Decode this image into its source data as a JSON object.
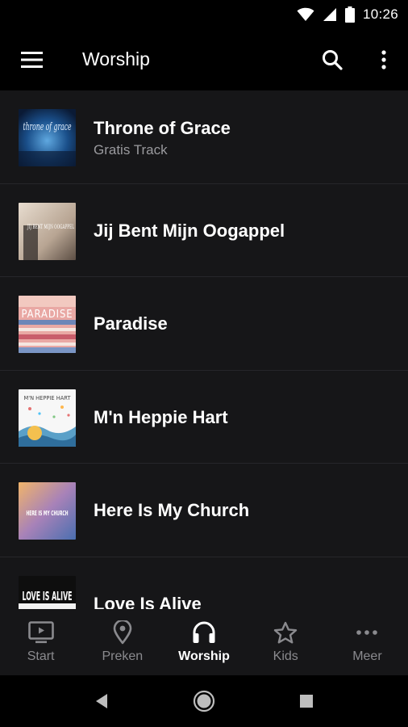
{
  "status": {
    "time": "10:26"
  },
  "header": {
    "title": "Worship"
  },
  "tracks": [
    {
      "title": "Throne of Grace",
      "subtitle": "Gratis Track",
      "art_text": "throne of grace"
    },
    {
      "title": "Jij Bent Mijn Oogappel",
      "art_text": "JIJ BENT MIJN OOGAPPEL"
    },
    {
      "title": "Paradise",
      "art_text": "PARADISE"
    },
    {
      "title": "M'n Heppie Hart",
      "art_text": "M'N HEPPIE HART"
    },
    {
      "title": "Here Is My Church",
      "art_text": "HERE IS MY CHURCH"
    },
    {
      "title": "Love Is Alive",
      "art_text": "LOVE IS ALIVE"
    }
  ],
  "bottom_nav": [
    {
      "label": "Start",
      "icon": "tv-icon"
    },
    {
      "label": "Preken",
      "icon": "location-pin-icon"
    },
    {
      "label": "Worship",
      "icon": "headphones-icon",
      "active": true
    },
    {
      "label": "Kids",
      "icon": "star-icon"
    },
    {
      "label": "Meer",
      "icon": "more-horizontal-icon"
    }
  ],
  "colors": {
    "background": "#161618",
    "bar": "#000000",
    "inactive": "#8a8a8e",
    "active": "#ffffff",
    "subtitle": "#9a9a9e"
  }
}
